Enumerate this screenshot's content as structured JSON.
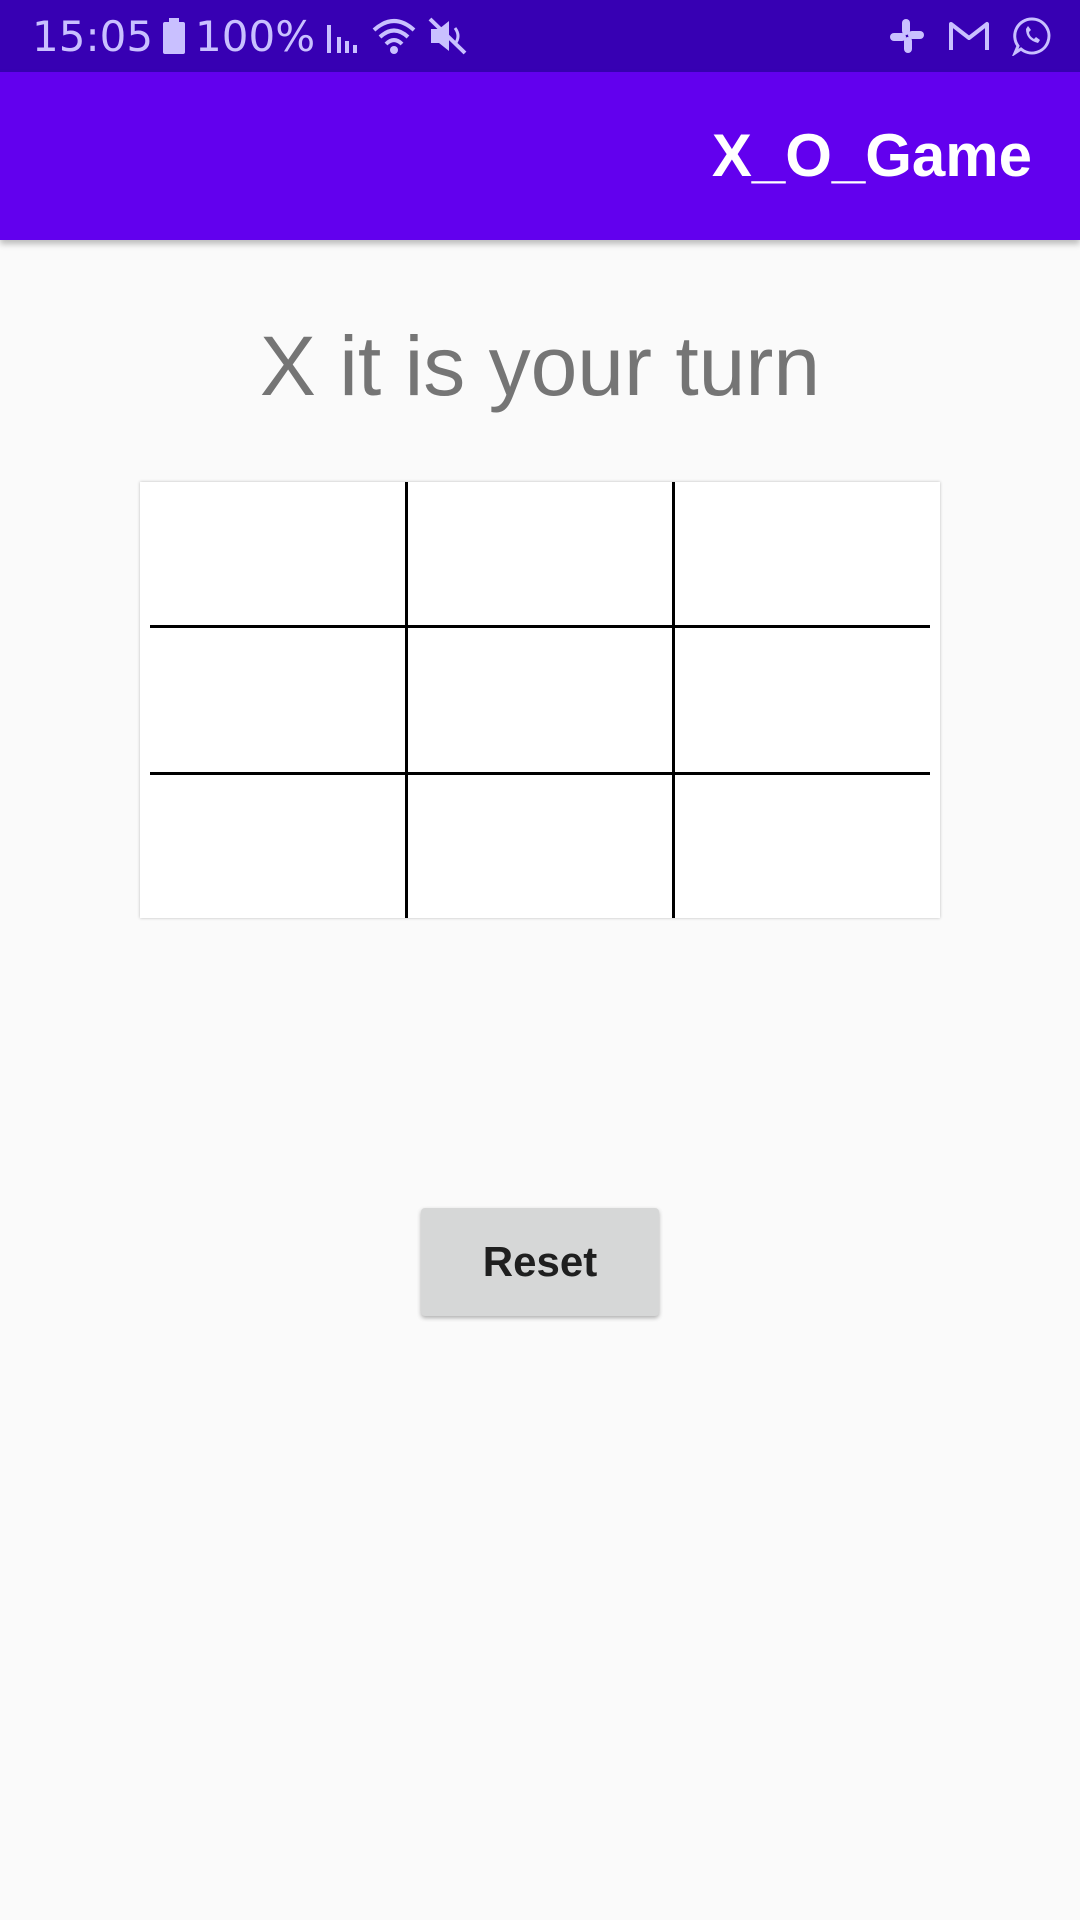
{
  "status_bar": {
    "time": "15:05",
    "battery": "100%",
    "icons": [
      "battery-icon",
      "signal-icon",
      "wifi-icon",
      "mute-icon",
      "slack-icon",
      "gmail-icon",
      "whatsapp-icon"
    ]
  },
  "app_bar": {
    "title": "X_O_Game"
  },
  "game": {
    "status_text": "X it is your turn",
    "board": [
      [
        "",
        "",
        ""
      ],
      [
        "",
        "",
        ""
      ],
      [
        "",
        "",
        ""
      ]
    ]
  },
  "actions": {
    "reset_label": "Reset"
  },
  "colors": {
    "status_bar": "#3700b3",
    "app_bar": "#6200ee",
    "background": "#fafafa",
    "button": "#d6d7d7",
    "status_text": "#757575"
  }
}
